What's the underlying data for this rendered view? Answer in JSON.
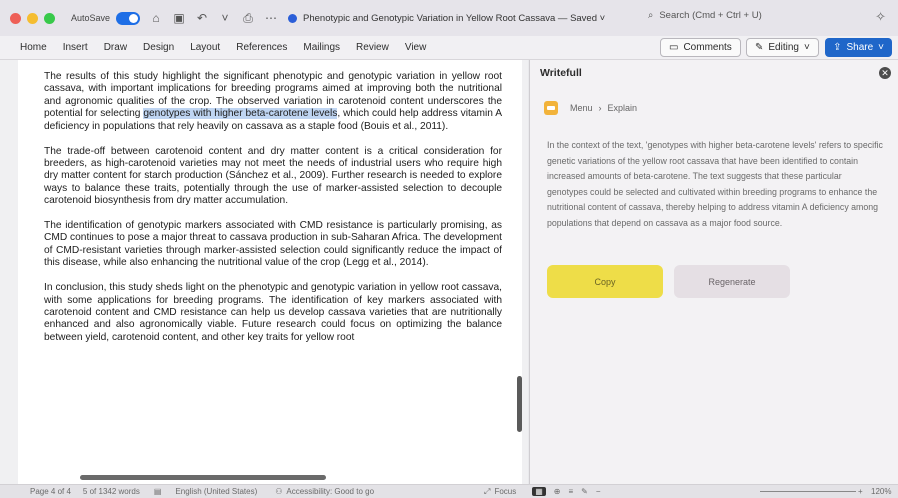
{
  "titlebar": {
    "autosave_label": "AutoSave",
    "document_title": "Phenotypic and Genotypic Variation in Yellow Root Cassava — Saved ˅",
    "search_placeholder": "Search (Cmd + Ctrl + U)"
  },
  "ribbon": {
    "tabs": [
      "Home",
      "Insert",
      "Draw",
      "Design",
      "Layout",
      "References",
      "Mailings",
      "Review",
      "View"
    ],
    "comments_label": "Comments",
    "editing_label": "Editing",
    "share_label": "Share"
  },
  "document": {
    "p1_before": "The results of this study highlight the significant phenotypic and genotypic variation in yellow root cassava, with important implications for breeding programs aimed at improving both the nutritional and agronomic qualities of the crop. The observed variation in carotenoid content underscores the potential for selecting ",
    "p1_highlight": "genotypes with higher beta-carotene levels",
    "p1_after": ", which could help address vitamin A deficiency in populations that rely heavily on cassava as a staple food (Bouis et al., 2011).",
    "p2": "The trade-off between carotenoid content and dry matter content is a critical consideration for breeders, as high-carotenoid varieties may not meet the needs of industrial users who require high dry matter content for starch production (Sánchez et al., 2009). Further research is needed to explore ways to balance these traits, potentially through the use of marker-assisted selection to decouple carotenoid biosynthesis from dry matter accumulation.",
    "p3": "The identification of genotypic markers associated with CMD resistance is particularly promising, as CMD continues to pose a major threat to cassava production in sub-Saharan Africa. The development of CMD-resistant varieties through marker-assisted selection could significantly reduce the impact of this disease, while also enhancing the nutritional value of the crop (Legg et al., 2014).",
    "p4": "In conclusion, this study sheds light on the phenotypic and genotypic variation in yellow root cassava, with some applications for breeding programs. The identification of key markers associated with carotenoid content and CMD resistance can help us develop cassava varieties that are nutritionally enhanced and also agronomically viable. Future research could focus on optimizing the balance between yield, carotenoid content, and other key traits for yellow root"
  },
  "writefull": {
    "title": "Writefull",
    "menu_label": "Menu",
    "separator": "›",
    "explain_label": "Explain",
    "explanation": "In the context of the text, 'genotypes with higher beta-carotene levels' refers to specific genetic variations of the yellow root cassava that have been identified to contain increased amounts of beta-carotene. The text suggests that these particular genotypes could be selected and cultivated within breeding programs to enhance the nutritional content of cassava, thereby helping to address vitamin A deficiency among populations that depend on cassava as a major food source.",
    "copy_label": "Copy",
    "regenerate_label": "Regenerate"
  },
  "statusbar": {
    "page": "Page 4 of 4",
    "words": "5 of 1342 words",
    "language": "English (United States)",
    "accessibility": "Accessibility: Good to go",
    "focus": "Focus",
    "zoom": "120%"
  },
  "colors": {
    "accent": "#1f66c9",
    "copy_button": "#eedd48",
    "highlight": "#bfd5f2"
  }
}
